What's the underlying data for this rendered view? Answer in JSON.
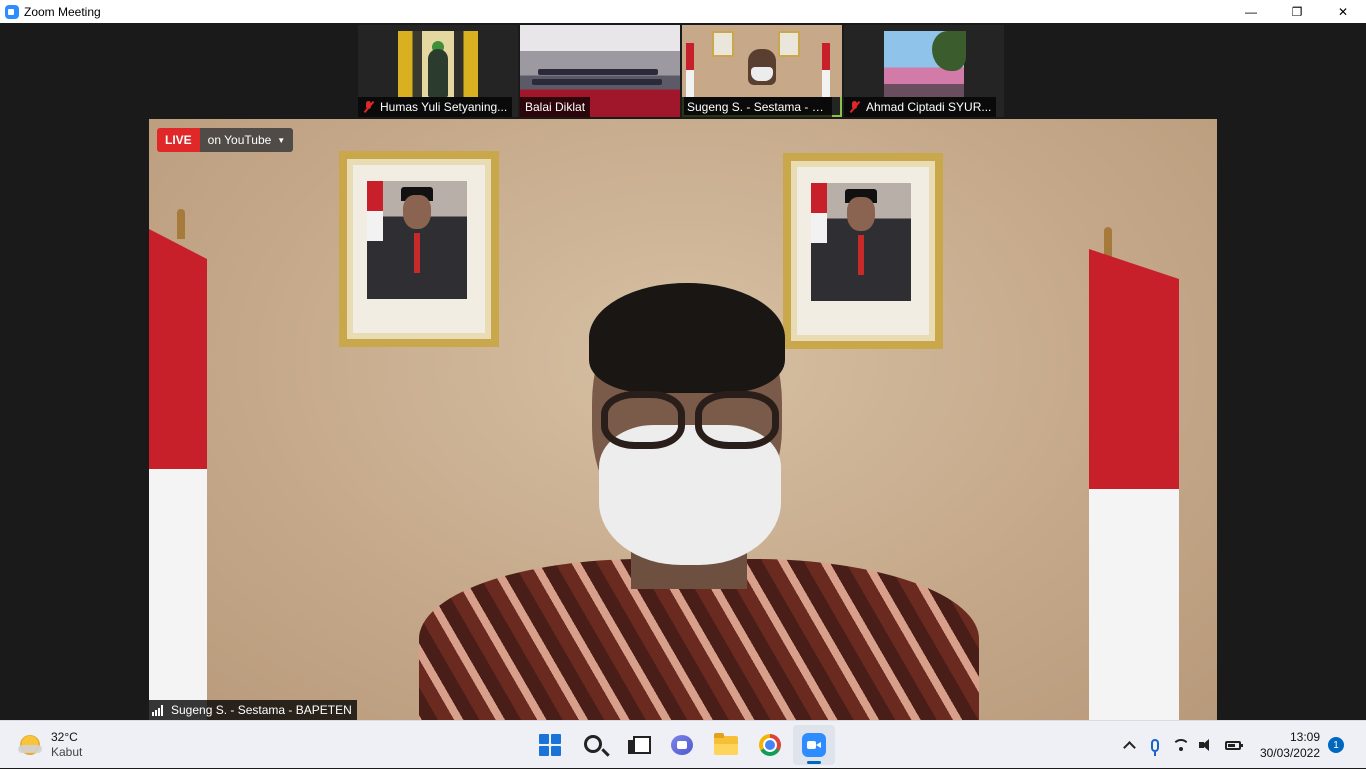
{
  "window": {
    "title": "Zoom Meeting",
    "controls": {
      "minimize": "—",
      "restore": "❐",
      "close": "✕"
    }
  },
  "gallery": {
    "participants": [
      {
        "name": "Humas Yuli Setyaning...",
        "muted": true,
        "active": false
      },
      {
        "name": "Balai Diklat",
        "muted": false,
        "active": false
      },
      {
        "name": "Sugeng S. - Sestama - B...",
        "muted": false,
        "active": true
      },
      {
        "name": "Ahmad Ciptadi SYUR...",
        "muted": true,
        "active": false
      }
    ]
  },
  "main_video": {
    "live_label": "LIVE",
    "stream_label": "on YouTube",
    "speaker_name": "Sugeng S. - Sestama - BAPETEN"
  },
  "taskbar": {
    "weather": {
      "temperature": "32°C",
      "condition": "Kabut"
    },
    "apps": [
      "start-icon",
      "search-icon",
      "task-view-icon",
      "chat-icon",
      "file-explorer-icon",
      "chrome-icon",
      "zoom-icon"
    ],
    "active_app": "zoom-icon",
    "clock": {
      "time": "13:09",
      "date": "30/03/2022"
    },
    "notification_count": "1"
  },
  "colors": {
    "live_red": "#e02828",
    "active_border": "#8bc34a",
    "accent": "#0067c0",
    "zoom_blue": "#2d8cff"
  }
}
